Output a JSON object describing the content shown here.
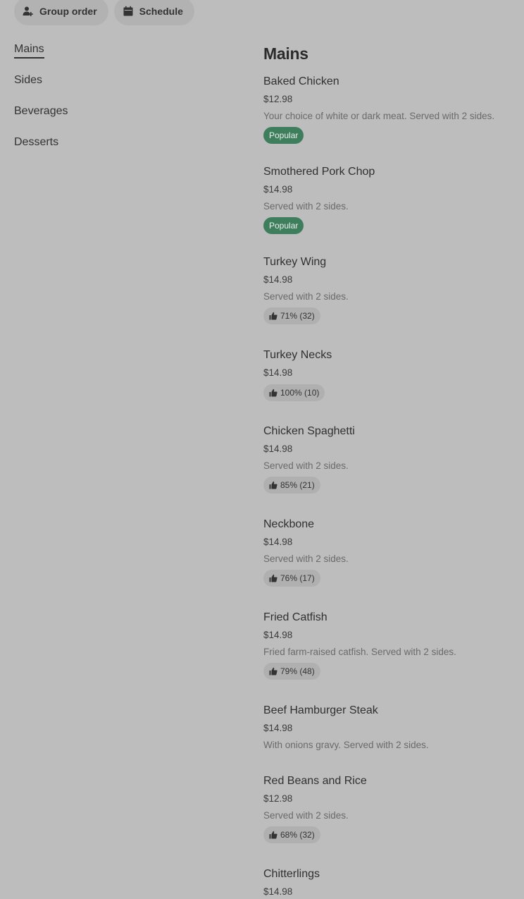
{
  "top_bar": {
    "group_order_label": "Group order",
    "schedule_label": "Schedule"
  },
  "sidebar": {
    "items": [
      {
        "label": "Mains",
        "active": true
      },
      {
        "label": "Sides",
        "active": false
      },
      {
        "label": "Beverages",
        "active": false
      },
      {
        "label": "Desserts",
        "active": false
      }
    ]
  },
  "main": {
    "section_title": "Mains",
    "items": [
      {
        "name": "Baked Chicken",
        "price": "$12.98",
        "desc": "Your choice of white or dark meat. Served with 2 sides.",
        "badge": "Popular"
      },
      {
        "name": "Smothered Pork Chop",
        "price": "$14.98",
        "desc": "Served with 2 sides.",
        "badge": "Popular"
      },
      {
        "name": "Turkey Wing",
        "price": "$14.98",
        "desc": "Served with 2 sides.",
        "rating": "71% (32)"
      },
      {
        "name": "Turkey Necks",
        "price": "$14.98",
        "rating": "100% (10)"
      },
      {
        "name": "Chicken Spaghetti",
        "price": "$14.98",
        "desc": "Served with 2 sides.",
        "rating": "85% (21)"
      },
      {
        "name": "Neckbone",
        "price": "$14.98",
        "desc": "Served with 2 sides.",
        "rating": "76% (17)"
      },
      {
        "name": "Fried Catfish",
        "price": "$14.98",
        "desc": "Fried farm-raised catfish. Served with 2 sides.",
        "rating": "79% (48)"
      },
      {
        "name": "Beef Hamburger Steak",
        "price": "$14.98",
        "desc": "With onions gravy. Served with 2 sides."
      },
      {
        "name": "Red Beans and Rice",
        "price": "$12.98",
        "desc": "Served with 2 sides.",
        "rating": "68% (32)"
      },
      {
        "name": "Chitterlings",
        "price": "$14.98"
      }
    ]
  },
  "colors": {
    "background": "#bdbdbd",
    "popular_badge": "#3f7e5d",
    "rating_badge": "#b0b0b0"
  }
}
